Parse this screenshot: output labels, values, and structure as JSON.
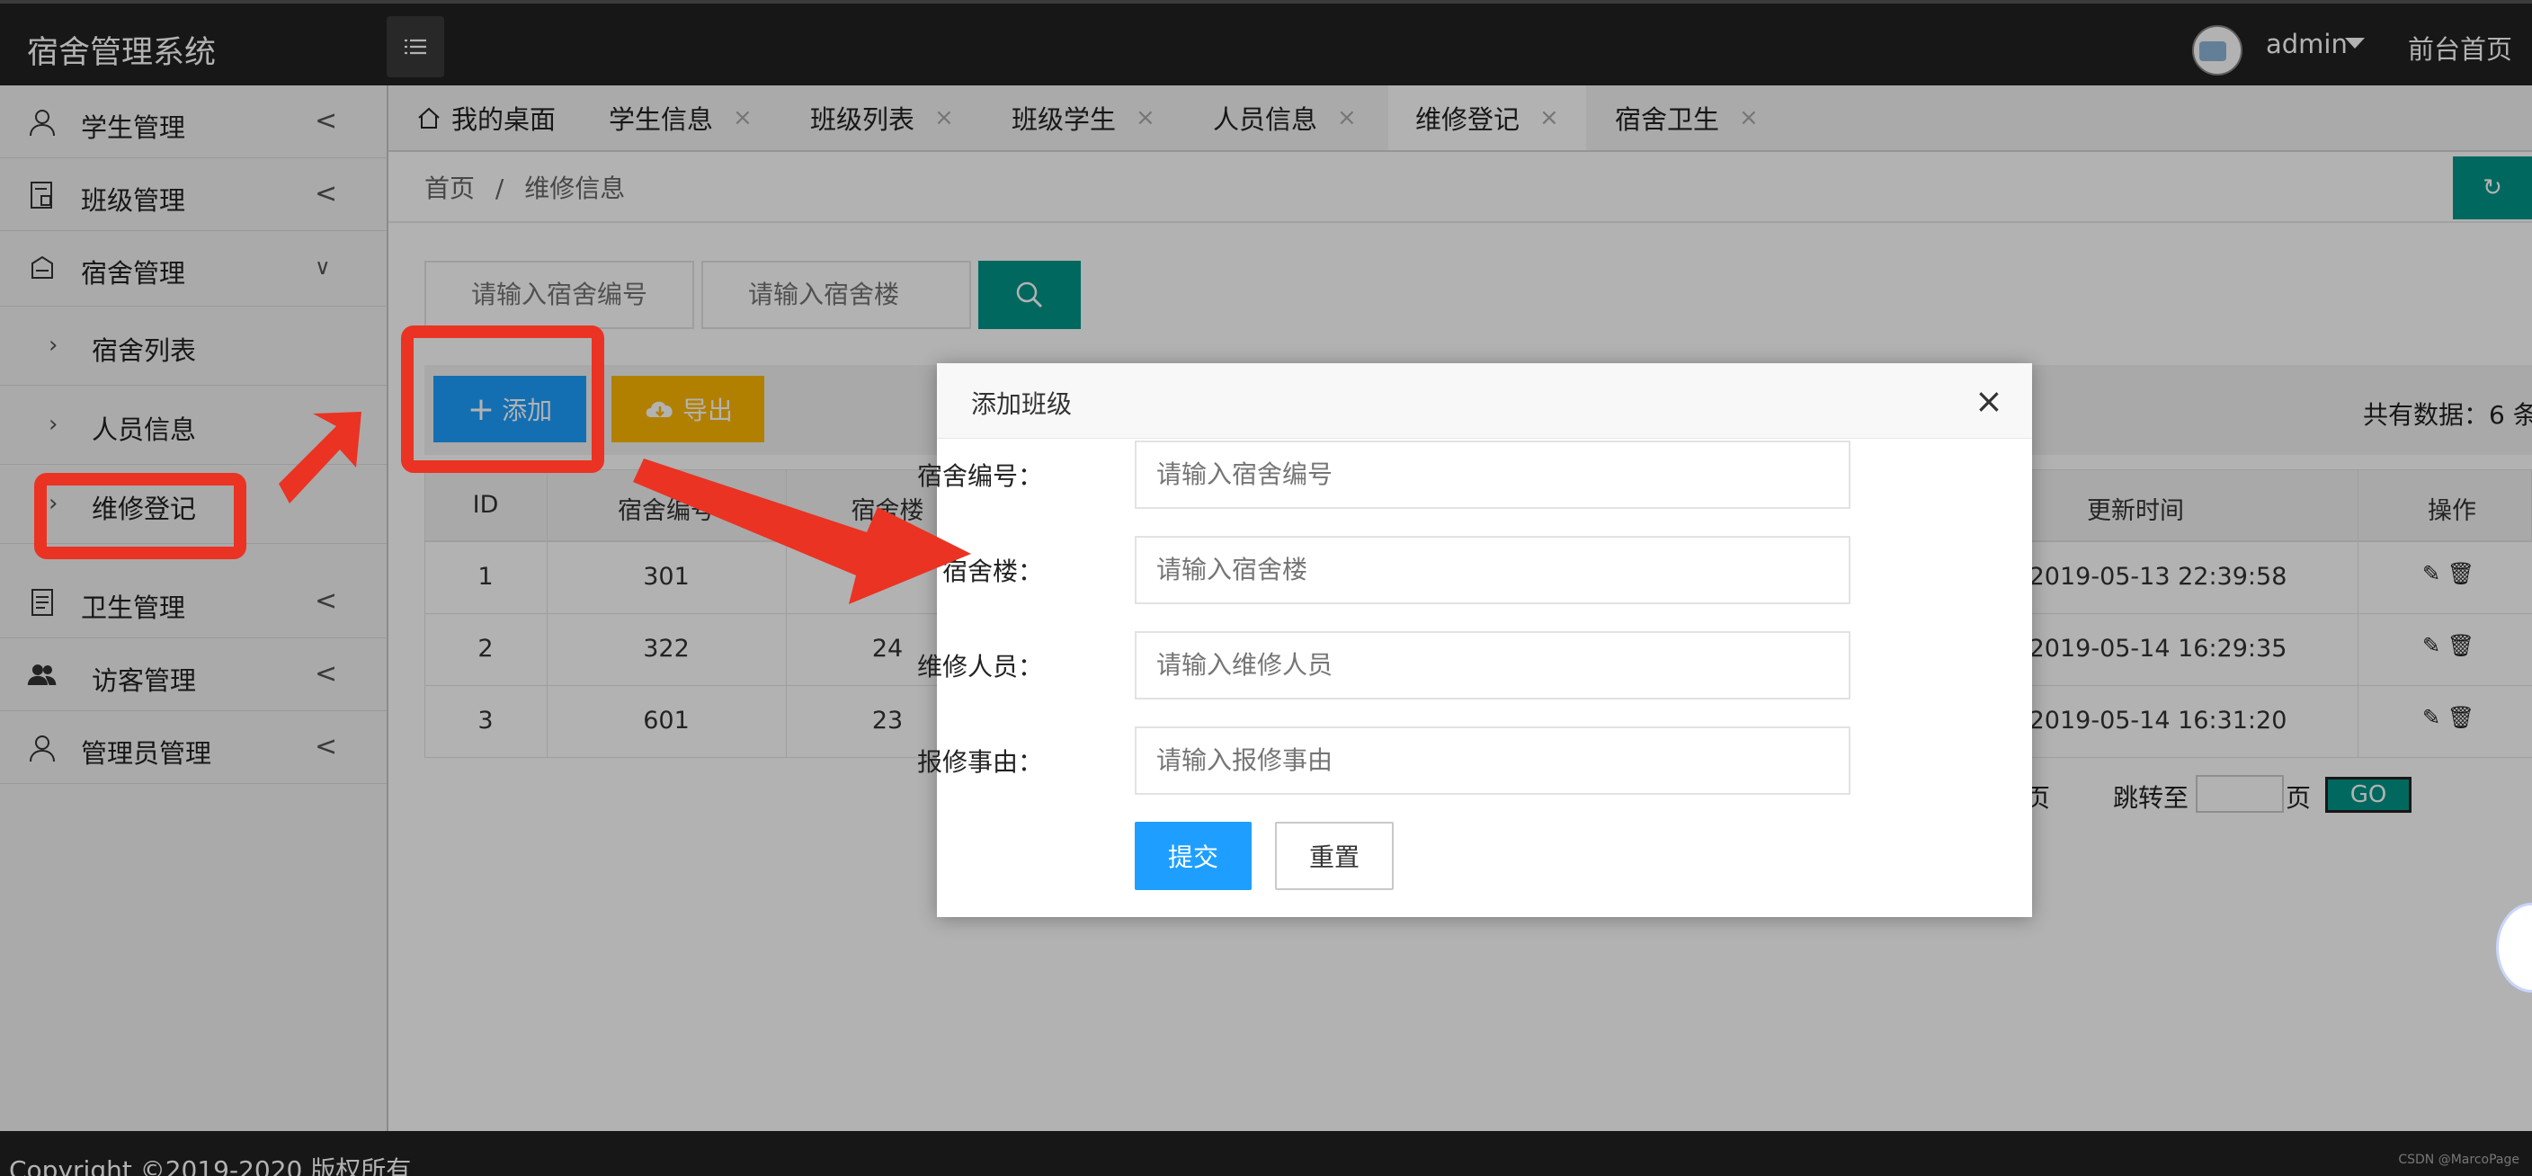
{
  "app": {
    "title": "宿舍管理系统"
  },
  "header": {
    "username": "admin",
    "front_link": "前台首页"
  },
  "sidebar": {
    "items": [
      {
        "label": "学生管理",
        "chevron": "<"
      },
      {
        "label": "班级管理",
        "chevron": "<"
      },
      {
        "label": "宿舍管理",
        "chevron": "∨"
      },
      {
        "label": "卫生管理",
        "chevron": "<"
      },
      {
        "label": "访客管理",
        "chevron": "<"
      },
      {
        "label": "管理员管理",
        "chevron": "<"
      }
    ],
    "subitems": [
      {
        "label": "宿舍列表"
      },
      {
        "label": "人员信息"
      },
      {
        "label": "维修登记"
      }
    ]
  },
  "tabs": [
    {
      "label": "我的桌面"
    },
    {
      "label": "学生信息"
    },
    {
      "label": "班级列表"
    },
    {
      "label": "班级学生"
    },
    {
      "label": "人员信息"
    },
    {
      "label": "维修登记"
    },
    {
      "label": "宿舍卫生"
    }
  ],
  "breadcrumb": {
    "home": "首页",
    "sep": "/",
    "current": "维修信息"
  },
  "search": {
    "dorm_no_placeholder": "请输入宿舍编号",
    "building_placeholder": "请输入宿舍楼"
  },
  "toolbar": {
    "add_label": "添加",
    "export_label": "导出",
    "total_label": "共有数据：6 条"
  },
  "table": {
    "headers": [
      "ID",
      "宿舍编号",
      "宿舍楼",
      "更新时间",
      "操作"
    ],
    "rows": [
      {
        "id": "1",
        "dorm": "301",
        "building": "",
        "time": "2019-05-13 22:39:58"
      },
      {
        "id": "2",
        "dorm": "322",
        "building": "24",
        "time": "2019-05-14 16:29:35"
      },
      {
        "id": "3",
        "dorm": "601",
        "building": "23",
        "time": "2019-05-14 16:31:20"
      }
    ]
  },
  "pager": {
    "page_suffix": "页",
    "jump_label": "跳转至",
    "page_unit": "页",
    "go_label": "GO"
  },
  "modal": {
    "title": "添加班级",
    "close": "×",
    "fields": [
      {
        "label": "宿舍编号：",
        "placeholder": "请输入宿舍编号"
      },
      {
        "label": "宿舍楼：",
        "placeholder": "请输入宿舍楼"
      },
      {
        "label": "维修人员：",
        "placeholder": "请输入维修人员"
      },
      {
        "label": "报修事由：",
        "placeholder": "请输入报修事由"
      }
    ],
    "submit_label": "提交",
    "reset_label": "重置"
  },
  "footer": {
    "copyright": "Copyright ©2019-2020 版权所有",
    "watermark": "CSDN @MarcoPage"
  },
  "colors": {
    "header_bg": "#222222",
    "primary": "#1e9fff",
    "teal": "#009688",
    "warn": "#ffb800",
    "annotation": "#ea3323"
  }
}
